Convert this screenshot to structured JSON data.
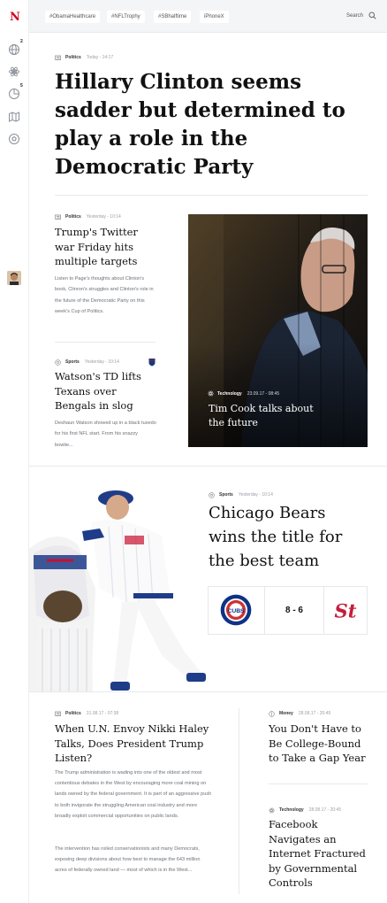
{
  "app": {
    "logo": "N"
  },
  "sidebar": {
    "items": [
      {
        "icon": "globe-icon",
        "badge": "2"
      },
      {
        "icon": "atom-icon",
        "badge": ""
      },
      {
        "icon": "chart-pie-icon",
        "badge": "5"
      },
      {
        "icon": "map-icon",
        "badge": ""
      },
      {
        "icon": "soccer-ball-icon",
        "badge": ""
      }
    ],
    "avatar": "user-avatar"
  },
  "topbar": {
    "tags": [
      "#ObamaHealthcare",
      "#NFLTrophy",
      "#SBhalftime",
      "iPhoneX"
    ],
    "search_label": "Search",
    "search_icon": "search-icon"
  },
  "hero": {
    "category": "Politics",
    "time": "Today - 14:17",
    "title": "Hillary Clinton seems sadder but determined to play a role in the Democratic Party"
  },
  "articles": {
    "trump": {
      "category": "Politics",
      "time": "Yesterday - 10:14",
      "title": "Trump's Twitter war Friday hits multiple targets",
      "body": "Listen to Page's thoughts about Clinton's book, Clinron's struggles and Clinton's role in the future of the Democratic Party on this week's Cup of Politics."
    },
    "watson": {
      "category": "Sports",
      "time": "Yesterday - 10:14",
      "title": "Watson's TD lifts Texans over Bengals in slog",
      "body": "Deshaun Watson showed up in a black tuxedo for his first NFL start. From his snazzy bowtie..."
    },
    "cook": {
      "category": "Technology",
      "time": "23.09.17 - 08:45",
      "title": "Tim Cook talks about the future"
    },
    "bears": {
      "category": "Sports",
      "time": "Yesterday - 10:14",
      "title": "Chicago Bears wins the title for the best team",
      "score": "8 - 6",
      "home_team": "CUBS",
      "away_team": "St"
    },
    "haley": {
      "category": "Politics",
      "time": "31.08.17 - 07:38",
      "title": "When U.N. Envoy Nikki Haley Talks, Does President Trump Listen?",
      "body1": "The Trump administration is wading into one of the oldest and most contentious debates in the West by encouraging more coal mining on lands owned by the federal government. It is part of an aggressive push to both invigorate the struggling American coal industry and more broadly exploit commercial opportunities on public lands.",
      "body2": "The intervention has roiled conservationists and many Democrats, exposing deep divisions about how best to manage the 643 million acres of federally owned land — most of which is in the West..."
    },
    "college": {
      "category": "Money",
      "time": "28.08.17 - 20:45",
      "title": "You Don't Have to Be College-Bound to Take a Gap Year"
    },
    "facebook": {
      "category": "Technology",
      "time": "28.08.17 - 20:45",
      "title": "Facebook Navigates an Internet Fractured by Governmental Controls"
    }
  },
  "colors": {
    "brand": "#d0021b",
    "cubs_blue": "#0e3386",
    "cubs_red": "#cc3433",
    "cardinals_red": "#c41e3a"
  }
}
